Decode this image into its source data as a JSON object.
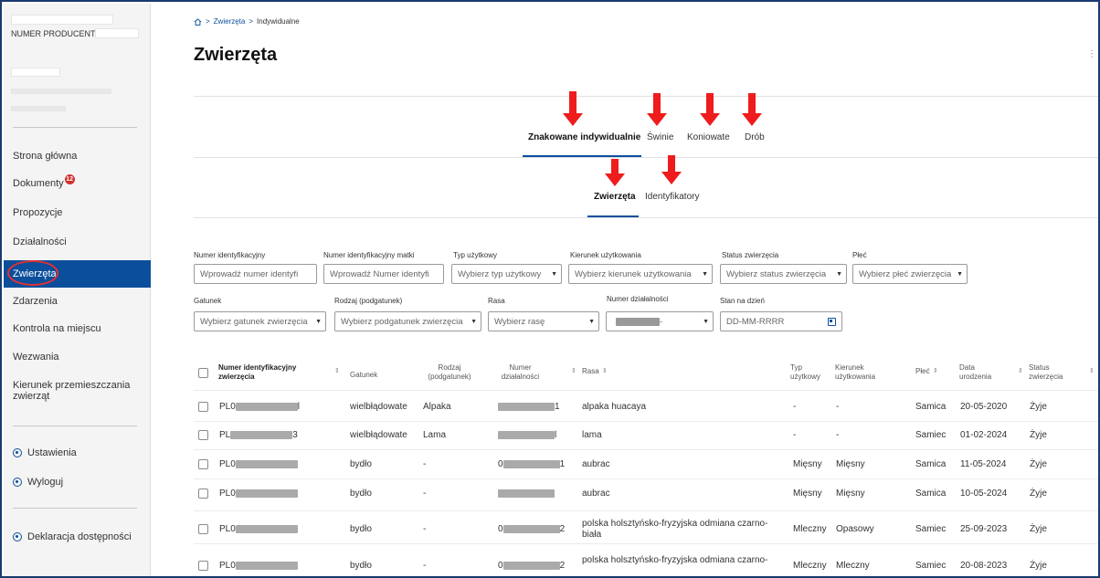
{
  "sidebar": {
    "producer_label": "NUMER PRODUCENTA:",
    "items": [
      {
        "label": "Strona główna"
      },
      {
        "label": "Dokumenty",
        "badge": "12"
      },
      {
        "label": "Propozycje"
      },
      {
        "label": "Działalności"
      },
      {
        "label": "Zwierzęta"
      },
      {
        "label": "Zdarzenia"
      },
      {
        "label": "Kontrola na miejscu"
      },
      {
        "label": "Wezwania"
      },
      {
        "label": "Kierunek przemieszczania zwierząt"
      }
    ],
    "settings": "Ustawienia",
    "logout": "Wyloguj",
    "accessibility": "Deklaracja dostępności"
  },
  "breadcrumb": {
    "sep1": ">",
    "item1": "Zwierzęta",
    "sep2": ">",
    "item2": "Indywidualne"
  },
  "page_title": "Zwierzęta",
  "kebab": "⋮",
  "tabs_top": [
    "Znakowane indywidualnie",
    "Świnie",
    "Koniowate",
    "Drób"
  ],
  "tabs_sub": [
    "Zwierzęta",
    "Identyfikatory"
  ],
  "filters": {
    "numer_id": {
      "label": "Numer identyfikacyjny",
      "placeholder": "Wprowadź numer identyfi"
    },
    "numer_matki": {
      "label": "Numer identyfikacyjny matki",
      "placeholder": "Wprowadź Numer identyfi"
    },
    "typ": {
      "label": "Typ użytkowy",
      "placeholder": "Wybierz typ użytkowy"
    },
    "kierunek": {
      "label": "Kierunek użytkowania",
      "placeholder": "Wybierz kierunek użytkowania"
    },
    "status": {
      "label": "Status zwierzęcia",
      "placeholder": "Wybierz status zwierzęcia"
    },
    "plec": {
      "label": "Płeć",
      "placeholder": "Wybierz płeć zwierzęcia"
    },
    "gatunek": {
      "label": "Gatunek",
      "placeholder": "Wybierz gatunek zwierzęcia"
    },
    "rodzaj": {
      "label": "Rodzaj (podgatunek)",
      "placeholder": "Wybierz podgatunek zwierzęcia"
    },
    "rasa": {
      "label": "Rasa",
      "placeholder": "Wybierz rasę"
    },
    "dzialalnosc": {
      "label": "Numer działalności",
      "value_suffix": "-"
    },
    "stan": {
      "label": "Stan na dzień",
      "placeholder": "DD-MM-RRRR"
    }
  },
  "table": {
    "headers": {
      "numer": "Numer identyfikacyjny zwierzęcia",
      "gatunek": "Gatunek",
      "rodzaj": "Rodzaj (podgatunek)",
      "dzialalnosc": "Numer działalności",
      "rasa": "Rasa",
      "typ": "Typ użytkowy",
      "kierunek": "Kierunek użytkowania",
      "plec": "Płeć",
      "data": "Data urodzenia",
      "status": "Status zwierzęcia"
    },
    "rows": [
      {
        "id_prefix": "PL0",
        "id_suffix": "l",
        "gatunek": "wielbłądowate",
        "rodzaj": "Alpaka",
        "dz_prefix": "",
        "dz_suffix": "1",
        "rasa": "alpaka huacaya",
        "typ": "-",
        "kierunek": "-",
        "plec": "Samica",
        "data": "20-05-2020",
        "status": "Żyje"
      },
      {
        "id_prefix": "PL",
        "id_suffix": "3",
        "gatunek": "wielbłądowate",
        "rodzaj": "Lama",
        "dz_prefix": "",
        "dz_suffix": "l",
        "rasa": "lama",
        "typ": "-",
        "kierunek": "-",
        "plec": "Samiec",
        "data": "01-02-2024",
        "status": "Żyje"
      },
      {
        "id_prefix": "PL0",
        "id_suffix": "",
        "gatunek": "bydło",
        "rodzaj": "-",
        "dz_prefix": "0",
        "dz_suffix": "1",
        "rasa": "aubrac",
        "typ": "Mięsny",
        "kierunek": "Mięsny",
        "plec": "Samica",
        "data": "11-05-2024",
        "status": "Żyje"
      },
      {
        "id_prefix": "PL0",
        "id_suffix": "",
        "gatunek": "bydło",
        "rodzaj": "-",
        "dz_prefix": "",
        "dz_suffix": "",
        "rasa": "aubrac",
        "typ": "Mięsny",
        "kierunek": "Mięsny",
        "plec": "Samica",
        "data": "10-05-2024",
        "status": "Żyje"
      },
      {
        "id_prefix": "PL0",
        "id_suffix": "",
        "gatunek": "bydło",
        "rodzaj": "-",
        "dz_prefix": "0",
        "dz_suffix": "2",
        "rasa": "polska holsztyńsko-fryzyjska odmiana czarno-biała",
        "typ": "Mleczny",
        "kierunek": "Opasowy",
        "plec": "Samiec",
        "data": "25-09-2023",
        "status": "Żyje"
      },
      {
        "id_prefix": "PL0",
        "id_suffix": "",
        "gatunek": "bydło",
        "rodzaj": "-",
        "dz_prefix": "0",
        "dz_suffix": "2",
        "rasa": "polska holsztyńsko-fryzyjska odmiana czarno-",
        "typ": "Mleczny",
        "kierunek": "Mleczny",
        "plec": "Samiec",
        "data": "20-08-2023",
        "status": "Żyje"
      }
    ]
  },
  "colors": {
    "accent": "#0b4f9c",
    "arrow": "#ee1c1c",
    "annotation": "#e53030",
    "badge": "#d32f2f"
  }
}
